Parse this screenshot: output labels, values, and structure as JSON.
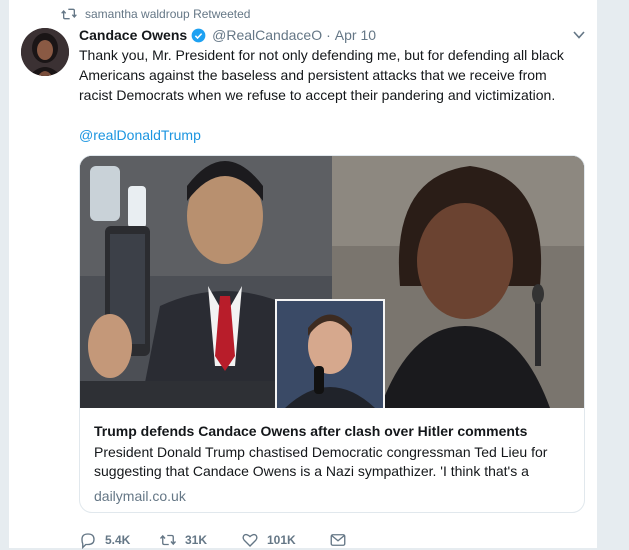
{
  "retweet_context": {
    "text": "samantha waldroup Retweeted",
    "icon": "retweet-icon"
  },
  "tweet": {
    "author_name": "Candace Owens",
    "author_handle": "@RealCandaceO",
    "separator": "·",
    "date": "Apr 10",
    "text": "Thank you, Mr. President for not only defending me, but for defending all black Americans against the baseless and persistent attacks that we receive from racist Democrats when we refuse to accept their pandering and victimization.",
    "mention": "@realDonaldTrump"
  },
  "link_card": {
    "title": "Trump defends Candace Owens after clash over Hitler comments",
    "description": "President Donald Trump chastised Democratic congressman Ted Lieu for suggesting that Candace Owens is a Nazi sympathizer. 'I think that's a",
    "domain": "dailymail.co.uk"
  },
  "actions": {
    "replies": "5.4K",
    "retweets": "31K",
    "likes": "101K"
  },
  "colors": {
    "link": "#1b95e0",
    "muted": "#657786",
    "verified": "#1da1f2",
    "background": "#e6ecf0"
  }
}
